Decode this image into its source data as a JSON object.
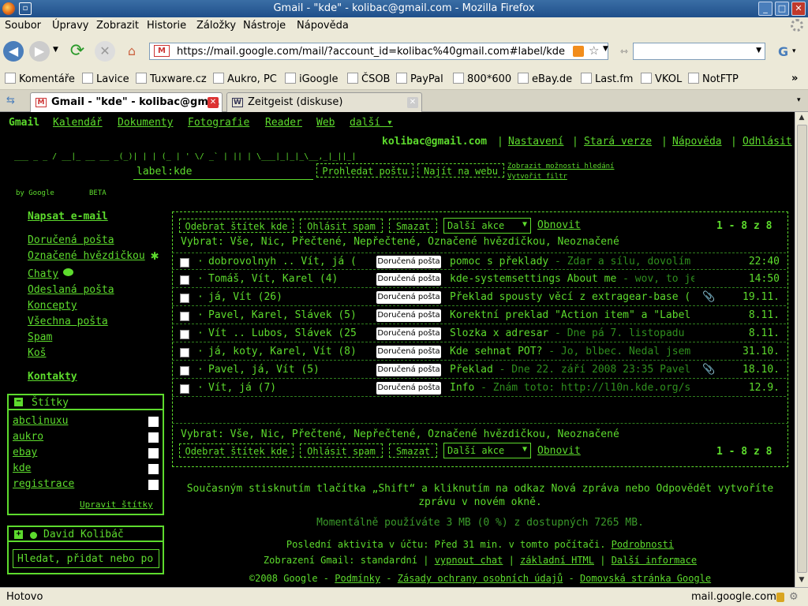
{
  "window": {
    "title": "Gmail - \"kde\" - kolibac@gmail.com - Mozilla Firefox",
    "minimize": "_",
    "maximize": "□",
    "close": "✕"
  },
  "menu": [
    "Soubor",
    "Úpravy",
    "Zobrazit",
    "Historie",
    "Záložky",
    "Nástroje",
    "Nápověda"
  ],
  "nav": {
    "url": "https://mail.google.com/mail/?account_id=kolibac%40gmail.com#label/kde",
    "search_value": ""
  },
  "bookmarks": [
    "Komentáře",
    "Lavice",
    "Tuxware.cz",
    "Aukro, PC",
    "iGoogle",
    "ČSOB",
    "PayPal",
    "800*600",
    "eBay.de",
    "Last.fm",
    "VKOL",
    "NotFTP"
  ],
  "bookmarks_more": "»",
  "tabs": [
    {
      "title": "Gmail - \"kde\" - kolibac@gm..."
    },
    {
      "title": "Zeitgeist (diskuse)"
    }
  ],
  "gmail": {
    "topnav": [
      "Gmail",
      "Kalendář",
      "Dokumenty",
      "Fotografie",
      "Reader",
      "Web",
      "další ▾"
    ],
    "user": {
      "email": "kolibac@gmail.com",
      "links": [
        "Nastavení",
        "Stará verze",
        "Nápověda",
        "Odhlásit"
      ],
      "separator": "|"
    },
    "logo": {
      "art": " ___           _  _\n/ __|_ __  __ _(_)| |\n| (_ | '  \\/ _` | || |\n \\___|_|_|_\\__,_|_||_|",
      "by": "by Google",
      "beta": "BETA"
    },
    "search": {
      "value": "label:kde",
      "search_mail": "Prohledat poštu",
      "search_web": "Najít na webu",
      "show_options": "Zobrazit možnosti hledání",
      "create_filter": "Vytvořit filtr"
    },
    "sidebar": {
      "compose": "Napsat e-mail",
      "items": [
        "Doručená pošta",
        "Označené hvězdičkou",
        "Chaty",
        "Odeslaná pošta",
        "Koncepty",
        "Všechna pošta",
        "Spam",
        "Koš"
      ],
      "star": "✱",
      "contacts": "Kontakty"
    },
    "labels": {
      "header": "Štítky",
      "toggle": "−",
      "items": [
        "abclinuxu",
        "aukro",
        "ebay",
        "kde",
        "registrace"
      ],
      "edit": "Upravit štítky"
    },
    "chat": {
      "toggle": "+",
      "name": "David Kolibáč",
      "placeholder": "Hledat, přidat nebo po"
    },
    "toolbar": {
      "remove_label": "Odebrat štítek kde",
      "report_spam": "Ohlásit spam",
      "delete": "Smazat",
      "more_actions": "Další akce",
      "refresh": "Obnovit",
      "count": "1 - 8 z 8"
    },
    "select": {
      "prefix": "Vybrat:",
      "options": [
        "Vše",
        "Nic",
        "Přečtené",
        "Nepřečtené",
        "Označené hvězdičkou",
        "Neoznačené"
      ]
    },
    "messages": [
      {
        "from": "dobrovolnyh .. Vít, já (",
        "label": "Doručená pošta",
        "subject": "pomoc s překlady",
        "snippet": " - Zdar a sílu, dovolím",
        "date": "22:40",
        "attach": false
      },
      {
        "from": "Tomáš, Vít, Karel (4)",
        "label": "Doručená pošta",
        "subject": "kde-systemsettings About me",
        "snippet": " - wov, to je",
        "date": "14:50",
        "attach": false
      },
      {
        "from": "já, Vít (26)",
        "label": "Doručená pošta",
        "subject": "Překlad spousty věcí z extragear-base (",
        "snippet": "",
        "date": "19.11.",
        "attach": true
      },
      {
        "from": "Pavel, Karel, Slávek (5)",
        "label": "Doručená pošta",
        "subject": "Korektní preklad \"Action item\" a \"Label",
        "snippet": "",
        "date": "8.11.",
        "attach": false
      },
      {
        "from": "Vít .. Lubos, Slávek (25",
        "label": "Doručená pošta",
        "subject": "Slozka x adresar",
        "snippet": " - Dne pá 7. listopadu",
        "date": "8.11.",
        "attach": false
      },
      {
        "from": "já, koty, Karel, Vít (8)",
        "label": "Doručená pošta",
        "subject": "Kde sehnat POT?",
        "snippet": " - Jo, blbec. Nedal jsem",
        "date": "31.10.",
        "attach": false
      },
      {
        "from": "Pavel, já, Vít (5)",
        "label": "Doručená pošta",
        "subject": "Překlad",
        "snippet": " - Dne 22. září 2008 23:35 Pavel",
        "date": "18.10.",
        "attach": true
      },
      {
        "from": "Vít, já (7)",
        "label": "Doručená pošta",
        "subject": "Info",
        "snippet": " - Znám toto: http://l10n.kde.org/s",
        "date": "12.9.",
        "attach": false
      }
    ],
    "tip": "Současným stisknutím tlačítka „Shift“ a kliknutím na odkaz Nová zpráva nebo Odpovědět vytvoříte zprávu v novém okně.",
    "storage": "Momentálně používáte 3 MB (0 %) z dostupných 7265 MB.",
    "activity": {
      "text": "Poslední aktivita v účtu: Před 31 min. v tomto počítači.",
      "details": "Podrobnosti"
    },
    "view": {
      "text": "Zobrazení Gmail: standardní",
      "chat_off": "vypnout chat",
      "basic_html": "základní HTML",
      "more_info": "Další informace"
    },
    "footer": {
      "copyright": "©2008 Google -",
      "terms": "Podmínky",
      "privacy": "Zásady ochrany osobních údajů",
      "home": "Domovská stránka Google"
    }
  },
  "status": {
    "text": "Hotovo",
    "host": "mail.google.com"
  }
}
